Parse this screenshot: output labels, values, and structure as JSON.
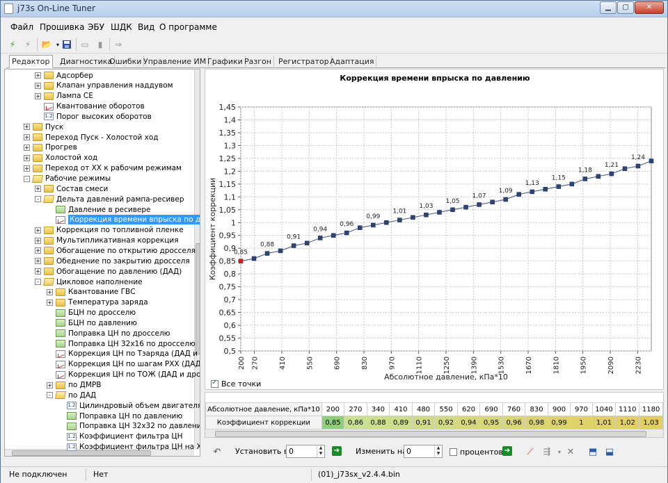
{
  "window": {
    "title": "j73s On-Line Tuner"
  },
  "menu": [
    "Файл",
    "Прошивка",
    "ЭБУ",
    "ШДК",
    "Вид",
    "О программе"
  ],
  "tabs": [
    {
      "label": "Редактор",
      "active": true
    },
    {
      "label": "Диагностика"
    },
    {
      "label": "Ошибки"
    },
    {
      "label": "Управление ИМ"
    },
    {
      "label": "Графики"
    },
    {
      "label": "Разгон"
    },
    {
      "label": "Регистратор"
    },
    {
      "label": "Адаптация"
    }
  ],
  "tree": [
    {
      "label": "Адсорбер",
      "level": 1,
      "expander": "+",
      "icon": "folder"
    },
    {
      "label": "Клапан управления наддувом",
      "level": 1,
      "expander": "+",
      "icon": "folder"
    },
    {
      "label": "Лампа CE",
      "level": 1,
      "expander": "+",
      "icon": "folder"
    },
    {
      "label": "Квантование оборотов",
      "level": 1,
      "expander": "",
      "icon": "graph"
    },
    {
      "label": "Порог высоких оборотов",
      "level": 1,
      "expander": "",
      "icon": "num"
    },
    {
      "label": "Пуск",
      "level": 0,
      "expander": "+",
      "icon": "folder"
    },
    {
      "label": "Переход Пуск - Холостой ход",
      "level": 0,
      "expander": "+",
      "icon": "folder"
    },
    {
      "label": "Прогрев",
      "level": 0,
      "expander": "+",
      "icon": "folder"
    },
    {
      "label": "Холостой ход",
      "level": 0,
      "expander": "+",
      "icon": "folder"
    },
    {
      "label": "Переход от ХХ к рабочим режимам",
      "level": 0,
      "expander": "+",
      "icon": "folder"
    },
    {
      "label": "Рабочие режимы",
      "level": 0,
      "expander": "-",
      "icon": "folder-open"
    },
    {
      "label": "Состав смеси",
      "level": 1,
      "expander": "+",
      "icon": "folder"
    },
    {
      "label": "Дельта давлений рампа-ресивер",
      "level": 1,
      "expander": "-",
      "icon": "folder-open"
    },
    {
      "label": "Давление в ресивере",
      "level": 2,
      "expander": "",
      "icon": "table"
    },
    {
      "label": "Коррекция времени впрыска по давл",
      "level": 2,
      "expander": "",
      "icon": "graph",
      "selected": true
    },
    {
      "label": "Коррекция по топливной пленке",
      "level": 1,
      "expander": "+",
      "icon": "folder"
    },
    {
      "label": "Мультипликативная коррекция",
      "level": 1,
      "expander": "+",
      "icon": "folder"
    },
    {
      "label": "Обогащение по открытию дросселя",
      "level": 1,
      "expander": "+",
      "icon": "folder"
    },
    {
      "label": "Обеднение по закрытию дросселя",
      "level": 1,
      "expander": "+",
      "icon": "folder"
    },
    {
      "label": "Обогащение по давлению (ДАД)",
      "level": 1,
      "expander": "+",
      "icon": "folder"
    },
    {
      "label": "Цикловое наполнение",
      "level": 1,
      "expander": "-",
      "icon": "folder-open"
    },
    {
      "label": "Квантование ГВС",
      "level": 2,
      "expander": "+",
      "icon": "folder"
    },
    {
      "label": "Температура заряда",
      "level": 2,
      "expander": "+",
      "icon": "folder"
    },
    {
      "label": "БЦН по дросселю",
      "level": 2,
      "expander": "",
      "icon": "table"
    },
    {
      "label": "БЦН по давлению",
      "level": 2,
      "expander": "",
      "icon": "table"
    },
    {
      "label": "Поправка ЦН по дросселю",
      "level": 2,
      "expander": "",
      "icon": "table"
    },
    {
      "label": "Поправка ЦН 32x16 по дросселю",
      "level": 2,
      "expander": "",
      "icon": "table"
    },
    {
      "label": "Коррекция ЦН по Тзаряда  (ДАД и д",
      "level": 2,
      "expander": "",
      "icon": "graph"
    },
    {
      "label": "Коррекция ЦН по шагам РХХ  (ДАД",
      "level": 2,
      "expander": "",
      "icon": "graph"
    },
    {
      "label": "Коррекция ЦН по ТОЖ  (ДАД и дрос",
      "level": 2,
      "expander": "",
      "icon": "graph"
    },
    {
      "label": "по ДМРВ",
      "level": 2,
      "expander": "+",
      "icon": "folder"
    },
    {
      "label": "по ДАД",
      "level": 2,
      "expander": "-",
      "icon": "folder-open"
    },
    {
      "label": "Цилиндровый объем двигателя",
      "level": 3,
      "expander": "",
      "icon": "num"
    },
    {
      "label": "Поправка ЦН по давлению",
      "level": 3,
      "expander": "",
      "icon": "table"
    },
    {
      "label": "Поправка ЦН 32x32 по давлению",
      "level": 3,
      "expander": "",
      "icon": "table"
    },
    {
      "label": "Коэффициент фильтра ЦН",
      "level": 3,
      "expander": "",
      "icon": "num"
    },
    {
      "label": "Коэффициент фильтра ЦН на ХХ",
      "level": 3,
      "expander": "",
      "icon": "num"
    }
  ],
  "chart_data": {
    "type": "line",
    "title": "Коррекция времени впрыска по давлению",
    "xlabel": "Абсолютное давление, кПа*10",
    "ylabel": "Коэффициент коррекции",
    "x": [
      200,
      270,
      340,
      410,
      480,
      550,
      620,
      690,
      760,
      830,
      900,
      970,
      1040,
      1110,
      1180,
      1250,
      1320,
      1390,
      1460,
      1530,
      1600,
      1670,
      1740,
      1810,
      1880,
      1950,
      2020,
      2090,
      2160,
      2230,
      2300
    ],
    "values": [
      0.85,
      0.86,
      0.88,
      0.89,
      0.91,
      0.92,
      0.94,
      0.95,
      0.96,
      0.98,
      0.99,
      1.0,
      1.01,
      1.02,
      1.03,
      1.04,
      1.05,
      1.06,
      1.07,
      1.08,
      1.09,
      1.11,
      1.12,
      1.13,
      1.14,
      1.15,
      1.17,
      1.18,
      1.19,
      1.21,
      1.22,
      1.24
    ],
    "x_ticks": [
      200,
      270,
      410,
      550,
      690,
      830,
      970,
      1110,
      1250,
      1390,
      1530,
      1670,
      1810,
      1950,
      2090,
      2230
    ],
    "ylim": [
      0.5,
      1.45
    ],
    "y_ticks": [
      "0,5",
      "0,55",
      "0,6",
      "0,65",
      "0,7",
      "0,75",
      "0,8",
      "0,85",
      "0,9",
      "0,95",
      "1",
      "1,05",
      "1,1",
      "1,15",
      "1,2",
      "1,25",
      "1,3",
      "1,35",
      "1,4",
      "1,45"
    ],
    "point_labels": [
      "0,85",
      "0,88",
      "0,91",
      "0,94",
      "0,96",
      "0,99",
      "1,01",
      "1,03",
      "1,05",
      "1,07",
      "1,09",
      "1,13",
      "1,15",
      "1,18",
      "1,21",
      "1,24"
    ],
    "grid": true,
    "line_color": "#3a4f8a",
    "marker_color": "#2d4476",
    "selected_marker_color": "#e21b1b"
  },
  "show_all_points": {
    "label": "Все точки",
    "checked": true
  },
  "table": {
    "row1_header": "Абсолютное давление, кПа*10",
    "row2_header": "Коэффициент коррекции",
    "headers": [
      "200",
      "270",
      "340",
      "410",
      "480",
      "550",
      "620",
      "690",
      "760",
      "830",
      "900",
      "970",
      "1040",
      "1110",
      "1180"
    ],
    "values": [
      "0,85",
      "0,86",
      "0,88",
      "0,89",
      "0,91",
      "0,92",
      "0,94",
      "0,95",
      "0,96",
      "0,98",
      "0,99",
      "1",
      "1,01",
      "1,02",
      "1,03"
    ]
  },
  "bottom": {
    "set_label": "Установить в",
    "set_value": "0",
    "change_label": "Изменить на",
    "change_value": "0",
    "percent_label": "процентов"
  },
  "status": {
    "connection": "Не подключен",
    "state": "Нет",
    "file": "(01)_j73sx_v2.4.4.bin"
  }
}
